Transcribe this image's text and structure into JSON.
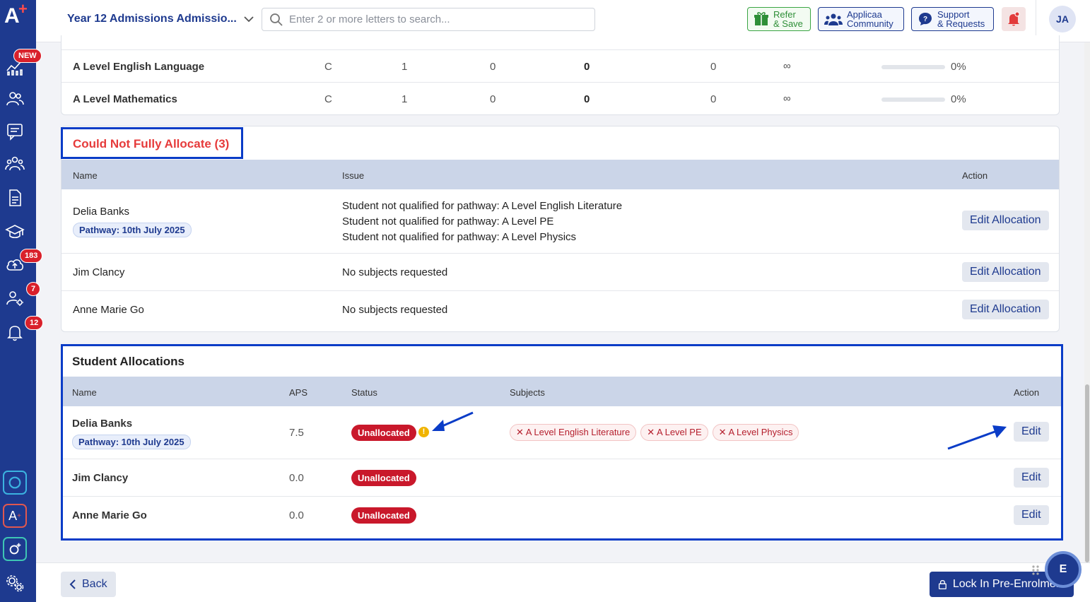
{
  "header": {
    "dropdown_label": "Year 12 Admissions Admissio...",
    "search_placeholder": "Enter 2 or more letters to search...",
    "refer": [
      "Refer",
      "& Save"
    ],
    "community": [
      "Applicaa",
      "Community"
    ],
    "support": [
      "Support",
      "& Requests"
    ],
    "avatar": "JA"
  },
  "sidebar": {
    "logo": "A",
    "badges": {
      "new": "NEW",
      "uploads": "183",
      "people": "7",
      "notifications": "12"
    }
  },
  "subjects_table": {
    "rows": [
      {
        "name": "A Level English Language",
        "grade": "C",
        "c1": "1",
        "c2": "0",
        "c3": "0",
        "c4": "0",
        "c5": "∞",
        "pct": "0%",
        "progress": 0
      },
      {
        "name": "A Level Mathematics",
        "grade": "C",
        "c1": "1",
        "c2": "0",
        "c3": "0",
        "c4": "0",
        "c5": "∞",
        "pct": "0%",
        "progress": 0
      }
    ]
  },
  "could_not_allocate": {
    "title": "Could Not Fully Allocate (3)",
    "headers": {
      "name": "Name",
      "issue": "Issue",
      "action": "Action"
    },
    "rows": [
      {
        "name": "Delia Banks",
        "pathway": "Pathway: 10th July 2025",
        "issues": [
          "Student not qualified for pathway: A Level English Literature",
          "Student not qualified for pathway: A Level PE",
          "Student not qualified for pathway: A Level Physics"
        ],
        "action": "Edit Allocation"
      },
      {
        "name": "Jim Clancy",
        "issues": [
          "No subjects requested"
        ],
        "action": "Edit Allocation"
      },
      {
        "name": "Anne Marie Go",
        "issues": [
          "No subjects requested"
        ],
        "action": "Edit Allocation"
      }
    ]
  },
  "student_allocations": {
    "title": "Student Allocations",
    "headers": {
      "name": "Name",
      "aps": "APS",
      "status": "Status",
      "subjects": "Subjects",
      "action": "Action"
    },
    "rows": [
      {
        "name": "Delia Banks",
        "pathway": "Pathway: 10th July 2025",
        "aps": "7.5",
        "status": "Unallocated",
        "subjects": [
          "A Level English Literature",
          "A Level PE",
          "A Level Physics"
        ],
        "action": "Edit"
      },
      {
        "name": "Jim Clancy",
        "aps": "0.0",
        "status": "Unallocated",
        "subjects": [],
        "action": "Edit"
      },
      {
        "name": "Anne Marie Go",
        "aps": "0.0",
        "status": "Unallocated",
        "subjects": [],
        "action": "Edit"
      }
    ]
  },
  "footer": {
    "back": "Back",
    "lock": "Lock In Pre-Enrolme...",
    "fab": "E"
  },
  "colors": {
    "brand": "#1e3a8f",
    "danger": "#c9182b",
    "highlight": "#0a3cc7",
    "warning": "#f0b400"
  }
}
